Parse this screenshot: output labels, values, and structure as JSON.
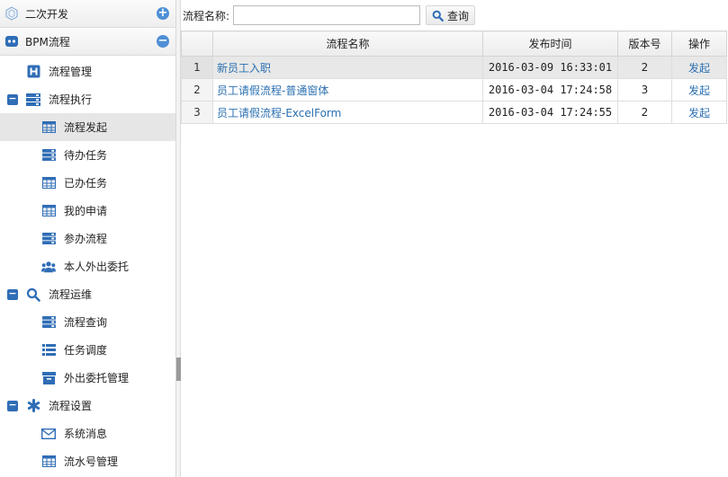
{
  "sidebar": {
    "header_top": {
      "label": "二次开发",
      "toggle": "+"
    },
    "header_bpm": {
      "label": "BPM流程",
      "toggle": "−"
    },
    "tree": {
      "manage": "流程管理",
      "exec": {
        "label": "流程执行",
        "expander": "−"
      },
      "exec_items": [
        "流程发起",
        "待办任务",
        "已办任务",
        "我的申请",
        "参办流程",
        "本人外出委托"
      ],
      "ops": {
        "label": "流程运维",
        "expander": "−"
      },
      "ops_items": [
        "流程查询",
        "任务调度",
        "外出委托管理"
      ],
      "settings": {
        "label": "流程设置",
        "expander": "−"
      },
      "settings_items": [
        "系统消息",
        "流水号管理"
      ]
    }
  },
  "search": {
    "label": "流程名称:",
    "value": "",
    "placeholder": "",
    "button": "查询"
  },
  "grid": {
    "columns": [
      "",
      "流程名称",
      "发布时间",
      "版本号",
      "操作"
    ],
    "rows": [
      {
        "num": "1",
        "name": "新员工入职",
        "time": "2016-03-09 16:33:01",
        "version": "2",
        "action": "发起"
      },
      {
        "num": "2",
        "name": "员工请假流程-普通窗体",
        "time": "2016-03-04 17:24:58",
        "version": "3",
        "action": "发起"
      },
      {
        "num": "3",
        "name": "员工请假流程-ExcelForm",
        "time": "2016-03-04 17:24:55",
        "version": "2",
        "action": "发起"
      }
    ]
  },
  "colors": {
    "accent": "#2f6db6",
    "link": "#2a6fb0",
    "selected": "#e6e6e6"
  }
}
